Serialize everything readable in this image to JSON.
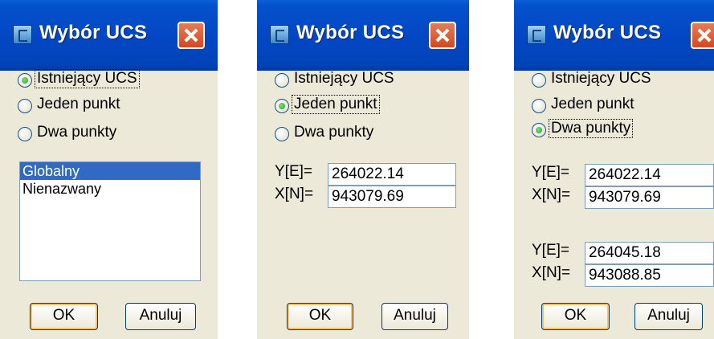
{
  "dialogs": [
    {
      "title": "Wybór UCS",
      "radio_options": [
        "Istniejący UCS",
        "Jeden punkt",
        "Dwa punkty"
      ],
      "selected_option": 0,
      "list_items": [
        "Globalny",
        "Nienazwany"
      ],
      "selected_list_item": 0,
      "ok_label": "OK",
      "cancel_label": "Anuluj"
    },
    {
      "title": "Wybór UCS",
      "radio_options": [
        "Istniejący UCS",
        "Jeden punkt",
        "Dwa punkty"
      ],
      "selected_option": 1,
      "point1": {
        "y_label": "Y[E]=",
        "y_value": "264022.14",
        "x_label": "X[N]=",
        "x_value": "943079.69"
      },
      "ok_label": "OK",
      "cancel_label": "Anuluj"
    },
    {
      "title": "Wybór UCS",
      "radio_options": [
        "Istniejący UCS",
        "Jeden punkt",
        "Dwa punkty"
      ],
      "selected_option": 2,
      "point1": {
        "y_label": "Y[E]=",
        "y_value": "264022.14",
        "x_label": "X[N]=",
        "x_value": "943079.69"
      },
      "point2": {
        "y_label": "Y[E]=",
        "y_value": "264045.18",
        "x_label": "X[N]=",
        "x_value": "943088.85"
      },
      "ok_label": "OK",
      "cancel_label": "Anuluj"
    }
  ],
  "colors": {
    "titlebar": "#0347c4",
    "dialog_bg": "#ece9d8",
    "selection": "#316ac5",
    "close_button": "#d14a1f",
    "radio_dot": "#21a121"
  },
  "icons": [
    "app-icon",
    "close-icon",
    "radio-icon"
  ]
}
